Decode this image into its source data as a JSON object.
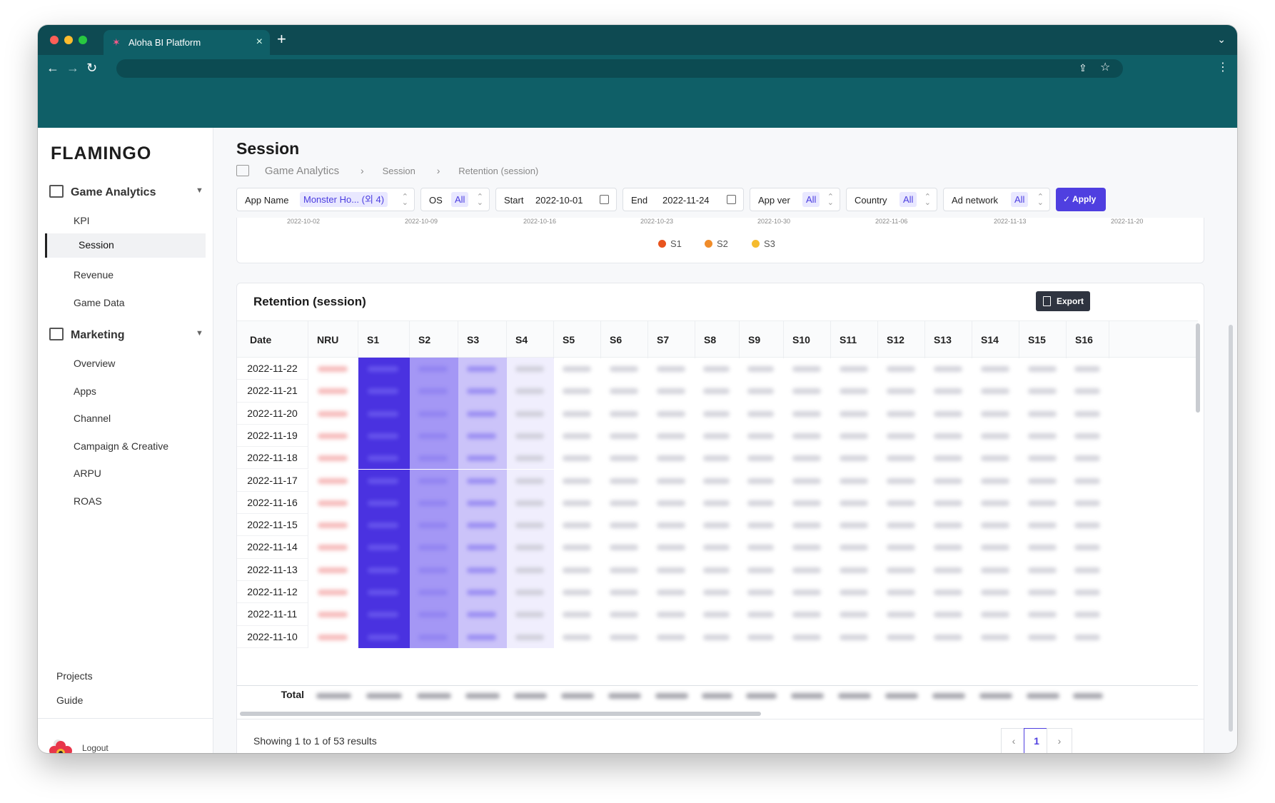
{
  "browser": {
    "tab_title": "Aloha BI Platform",
    "tab_close": "×",
    "new_tab": "+",
    "tab_menu": "⌄",
    "back": "←",
    "forward": "→",
    "reload": "↻",
    "share": "⇪",
    "bookmark": "☆",
    "menu": "⋮"
  },
  "sidebar": {
    "logo": "FLAMINGO",
    "groups": [
      {
        "label": "Game Analytics",
        "items": [
          "KPI",
          "Session",
          "Revenue",
          "Game Data"
        ]
      },
      {
        "label": "Marketing",
        "items": [
          "Overview",
          "Apps",
          "Channel",
          "Campaign & Creative",
          "ARPU",
          "ROAS"
        ]
      }
    ],
    "active_item": "Session",
    "footer_links": [
      "Projects",
      "Guide"
    ],
    "logout": "Logout"
  },
  "page": {
    "title": "Session",
    "breadcrumb": [
      "Game Analytics",
      "Session",
      "Retention (session)"
    ],
    "breadcrumb_sep": "›"
  },
  "filters": {
    "app_name_label": "App Name",
    "app_name_value": "Monster Ho... (외 4)",
    "os_label": "OS",
    "os_value": "All",
    "start_label": "Start",
    "start_value": "2022-10-01",
    "end_label": "End",
    "end_value": "2022-11-24",
    "app_ver_label": "App ver",
    "app_ver_value": "All",
    "country_label": "Country",
    "country_value": "All",
    "ad_network_label": "Ad network",
    "ad_network_value": "All",
    "apply_label": "✓ Apply"
  },
  "chart": {
    "x_ticks": [
      "2022-10-02",
      "2022-10-09",
      "2022-10-16",
      "2022-10-23",
      "2022-10-30",
      "2022-11-06",
      "2022-11-13",
      "2022-11-20"
    ],
    "legend": [
      {
        "name": "S1",
        "color": "#e8541e"
      },
      {
        "name": "S2",
        "color": "#f08c2a"
      },
      {
        "name": "S3",
        "color": "#f5bb2e"
      }
    ]
  },
  "table": {
    "title": "Retention (session)",
    "export_label": "Export",
    "columns": [
      "Date",
      "NRU",
      "S1",
      "S2",
      "S3",
      "S4",
      "S5",
      "S6",
      "S7",
      "S8",
      "S9",
      "S10",
      "S11",
      "S12",
      "S13",
      "S14",
      "S15",
      "S16"
    ],
    "dates": [
      "2022-11-22",
      "2022-11-21",
      "2022-11-20",
      "2022-11-19",
      "2022-11-18",
      "2022-11-17",
      "2022-11-16",
      "2022-11-15",
      "2022-11-14",
      "2022-11-13",
      "2022-11-12",
      "2022-11-11",
      "2022-11-10"
    ],
    "total_label": "Total",
    "showing": "Showing 1 to 1 of 53 results",
    "page_prev": "‹",
    "page_current": "1",
    "page_next": "›"
  },
  "colors": {
    "accent": "#4f3fe0",
    "header": "#0f5f67",
    "nru_cells": "#f3a5a5",
    "s1_cells": "#4a32e0"
  }
}
